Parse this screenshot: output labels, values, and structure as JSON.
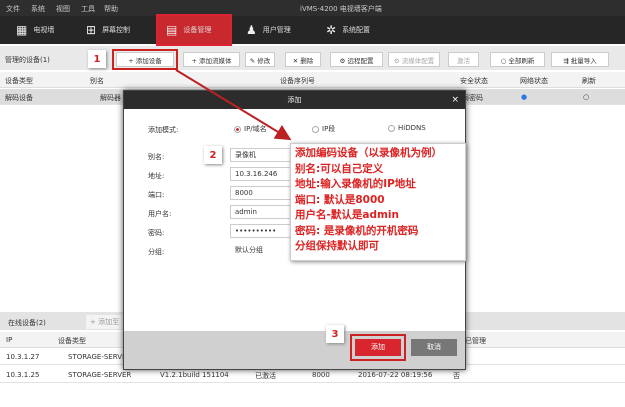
{
  "menu": [
    "文件",
    "系统",
    "视图",
    "工具",
    "帮助"
  ],
  "app_title": "iVMS-4200 电视墙客户端",
  "nav": [
    {
      "label": "电视墙",
      "icon": "video-wall-icon"
    },
    {
      "label": "屏幕控制",
      "icon": "screen-grid-icon"
    },
    {
      "label": "设备管理",
      "icon": "device-icon",
      "active": true
    },
    {
      "label": "用户管理",
      "icon": "user-icon"
    },
    {
      "label": "系统配置",
      "icon": "gear-icon"
    }
  ],
  "toolbar": {
    "title": "管理的设备(1)",
    "step": "1",
    "buttons": [
      "+ 添加设备",
      "+ 添加流媒体",
      "✎ 修改",
      "✕ 删除",
      "⚙ 远程配置",
      "⚙ 流媒体配置",
      "激活",
      "○ 全部刷新",
      "⇶ 批量导入"
    ]
  },
  "table": {
    "headers": [
      "设备类型",
      "别名",
      "设备序列号",
      "安全状态",
      "网络状态",
      "刷新"
    ],
    "row": [
      "解码设备",
      "解码器",
      "弱密码"
    ]
  },
  "dialog": {
    "title": "添加",
    "close": "×",
    "mode_label": "添加模式:",
    "modes": [
      "IP/域名",
      "IP段",
      "HiDDNS"
    ],
    "fields": [
      {
        "label": "别名:",
        "value": "录像机"
      },
      {
        "label": "地址:",
        "value": "10.3.16.246"
      },
      {
        "label": "端口:",
        "value": "8000"
      },
      {
        "label": "用户名:",
        "value": "admin"
      },
      {
        "label": "密码:",
        "value": "••••••••••"
      },
      {
        "label": "分组:",
        "value": "默认分组"
      }
    ],
    "step2": "2",
    "step3": "3",
    "add": "添加",
    "cancel": "取消"
  },
  "note": [
    "添加编码设备（以录像机为例）",
    "别名:可以自己定义",
    "地址:输入录像机的IP地址",
    "端口: 默认是8000",
    "用户名-默认是admin",
    "密码: 是录像机的开机密码",
    "分组保持默认即可"
  ],
  "online": {
    "title": "在线设备(2)",
    "add": "+ 添加至",
    "headers": [
      "IP",
      "设备类型",
      "已管理"
    ],
    "rows": [
      [
        "10.3.1.27",
        "STORAGE-SERVER",
        "",
        "",
        "",
        "",
        "否"
      ],
      [
        "10.3.1.25",
        "STORAGE-SERVER",
        "V1.2.1build 151104",
        "已激活",
        "8000",
        "2016-07-22 08:19:56",
        "否"
      ]
    ]
  },
  "colors": {
    "accent": "#c8282e",
    "dark": "#2a2a2a"
  }
}
